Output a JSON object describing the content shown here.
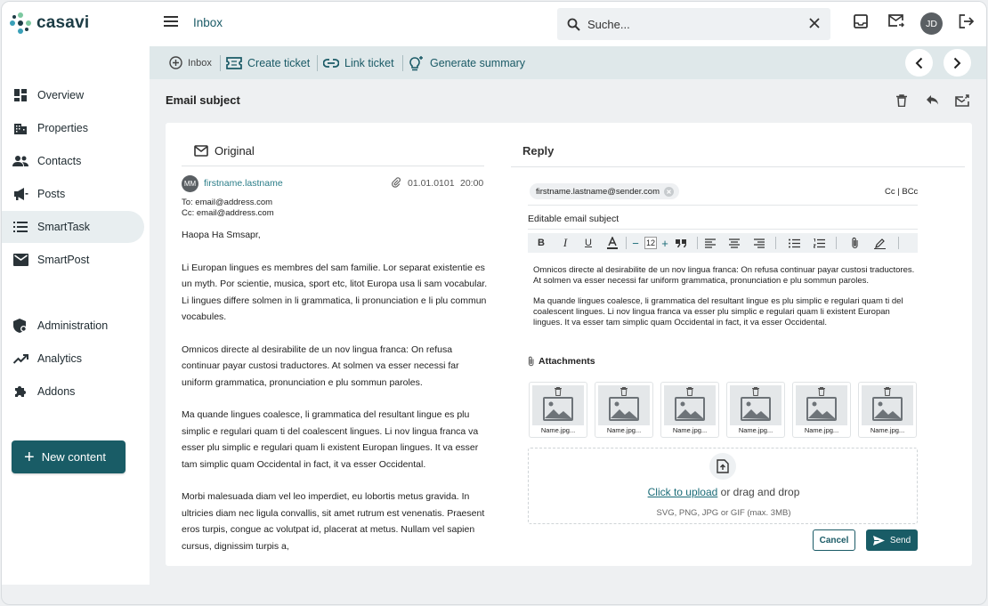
{
  "brand": {
    "name": "casavi"
  },
  "sidebar": {
    "items": [
      {
        "label": "Overview",
        "icon": "dashboard-icon"
      },
      {
        "label": "Properties",
        "icon": "building-icon"
      },
      {
        "label": "Contacts",
        "icon": "people-icon"
      },
      {
        "label": "Posts",
        "icon": "megaphone-icon"
      },
      {
        "label": "SmartTask",
        "icon": "list-icon",
        "active": true
      },
      {
        "label": "SmartPost",
        "icon": "mail-icon"
      },
      {
        "label": "Administration",
        "icon": "admin-shield-icon"
      },
      {
        "label": "Analytics",
        "icon": "trending-icon"
      },
      {
        "label": "Addons",
        "icon": "puzzle-icon"
      }
    ],
    "new_content": "New content"
  },
  "topbar": {
    "title": "Inbox",
    "search_placeholder": "Suche...",
    "avatar_initials": "JD"
  },
  "actionbar": {
    "inbox": "Inbox",
    "create_ticket": "Create ticket",
    "link_ticket": "Link ticket",
    "generate_summary": "Generate summary"
  },
  "email": {
    "subject": "Email subject",
    "original_label": "Original",
    "sender_initials": "MM",
    "sender": "firstname.lastname",
    "date": "01.01.0101",
    "time": "20:00",
    "to": "To: email@address.com",
    "cc": "Cc: email@address.com",
    "body": [
      "Haopa Ha Smsapr,",
      "Li Europan lingues es membres del sam familie. Lor separat existentie es un myth. Por scientie, musica, sport etc, litot Europa usa li sam vocabular. Li lingues differe solmen in li grammatica, li pronunciation e li plu commun vocabules.",
      "Omnicos directe al desirabilite de un nov lingua franca: On refusa continuar payar custosi traductores. At solmen va esser necessi far uniform grammatica, pronunciation e plu sommun paroles.",
      "Ma quande lingues coalesce, li grammatica del resultant lingue es plu simplic e regulari quam ti del coalescent lingues. Li nov lingua franca va esser plu simplic e regulari quam li existent Europan lingues. It va esser tam simplic quam Occidental in fact, it va esser Occidental.",
      "Morbi malesuada diam vel leo imperdiet, eu lobortis metus gravida. In ultricies diam nec ligula convallis, sit amet rutrum est venenatis. Praesent eros turpis, congue ac volutpat id, placerat at metus. Nullam vel sapien cursus, dignissim turpis a,"
    ]
  },
  "reply": {
    "label": "Reply",
    "recipient": "firstname.lastname@sender.com",
    "cc_bcc": "Cc | BCc",
    "subject": "Editable email subject",
    "font_size": "12",
    "text": [
      "Omnicos directe al desirabilite de un nov lingua franca: On refusa continuar payar custosi traductores. At solmen va esser necessi far uniform grammatica, pronunciation e plu sommun paroles.",
      "Ma quande lingues coalesce, li grammatica del resultant lingue es plu simplic e regulari quam ti del coalescent lingues. Li nov lingua franca va esser plu simplic e regulari quam li existent Europan lingues. It va esser tam simplic quam Occidental in fact, it va esser Occidental."
    ],
    "attachments_label": "Attachments",
    "attachments": [
      "Name.jpg...",
      "Name.jpg...",
      "Name.jpg...",
      "Name.jpg...",
      "Name.jpg...",
      "Name.jpg..."
    ],
    "upload_link": "Click to upload",
    "upload_rest": " or drag and drop",
    "upload_hint": "SVG, PNG, JPG or GIF (max. 3MB)",
    "cancel": "Cancel",
    "send": "Send"
  },
  "colors": {
    "accent": "#195c66",
    "link": "#2a7d88",
    "actionbar": "#dfe8ea",
    "background": "#eef0f2"
  }
}
